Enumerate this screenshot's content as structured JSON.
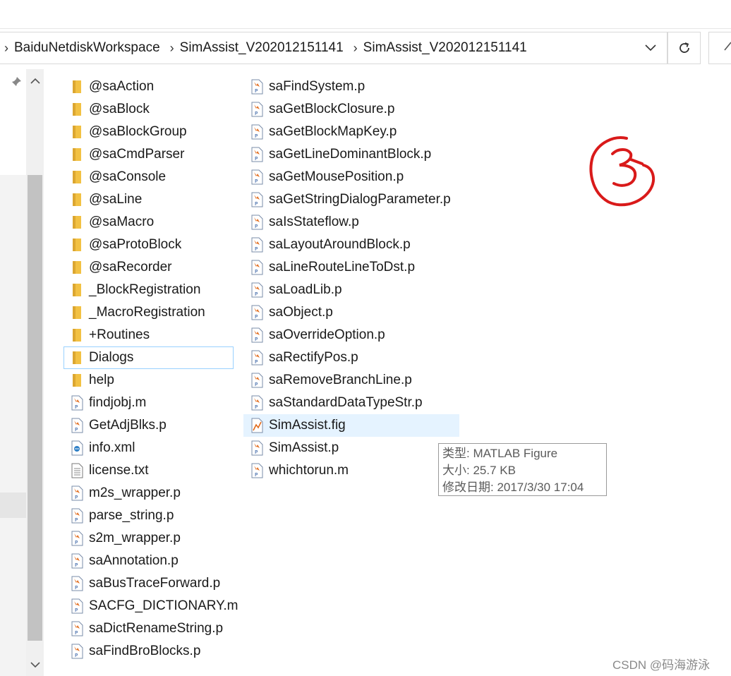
{
  "address_bar": {
    "breadcrumbs": [
      "BaiduNetdiskWorkspace",
      "SimAssist_V202012151141",
      "SimAssist_V202012151141"
    ]
  },
  "folders": [
    "@saAction",
    "@saBlock",
    "@saBlockGroup",
    "@saCmdParser",
    "@saConsole",
    "@saLine",
    "@saMacro",
    "@saProtoBlock",
    "@saRecorder",
    "_BlockRegistration",
    "_MacroRegistration",
    "+Routines",
    "Dialogs",
    "help"
  ],
  "files_col1": [
    {
      "name": "findjobj.m",
      "icon": "matlab-file-icon"
    },
    {
      "name": "GetAdjBlks.p",
      "icon": "matlab-file-icon"
    },
    {
      "name": "info.xml",
      "icon": "xml-file-icon"
    },
    {
      "name": "license.txt",
      "icon": "text-file-icon"
    },
    {
      "name": "m2s_wrapper.p",
      "icon": "matlab-file-icon"
    },
    {
      "name": "parse_string.p",
      "icon": "matlab-file-icon"
    },
    {
      "name": "s2m_wrapper.p",
      "icon": "matlab-file-icon"
    },
    {
      "name": "saAnnotation.p",
      "icon": "matlab-file-icon"
    },
    {
      "name": "saBusTraceForward.p",
      "icon": "matlab-file-icon"
    },
    {
      "name": "SACFG_DICTIONARY.m",
      "icon": "matlab-file-icon"
    },
    {
      "name": "saDictRenameString.p",
      "icon": "matlab-file-icon"
    },
    {
      "name": "saFindBroBlocks.p",
      "icon": "matlab-file-icon"
    }
  ],
  "files_col2": [
    {
      "name": "saFindSystem.p",
      "icon": "matlab-file-icon"
    },
    {
      "name": "saGetBlockClosure.p",
      "icon": "matlab-file-icon"
    },
    {
      "name": "saGetBlockMapKey.p",
      "icon": "matlab-file-icon"
    },
    {
      "name": "saGetLineDominantBlock.p",
      "icon": "matlab-file-icon"
    },
    {
      "name": "saGetMousePosition.p",
      "icon": "matlab-file-icon"
    },
    {
      "name": "saGetStringDialogParameter.p",
      "icon": "matlab-file-icon"
    },
    {
      "name": "saIsStateflow.p",
      "icon": "matlab-file-icon"
    },
    {
      "name": "saLayoutAroundBlock.p",
      "icon": "matlab-file-icon"
    },
    {
      "name": "saLineRouteLineToDst.p",
      "icon": "matlab-file-icon"
    },
    {
      "name": "saLoadLib.p",
      "icon": "matlab-file-icon"
    },
    {
      "name": "saObject.p",
      "icon": "matlab-file-icon"
    },
    {
      "name": "saOverrideOption.p",
      "icon": "matlab-file-icon"
    },
    {
      "name": "saRectifyPos.p",
      "icon": "matlab-file-icon"
    },
    {
      "name": "saRemoveBranchLine.p",
      "icon": "matlab-file-icon"
    },
    {
      "name": "saStandardDataTypeStr.p",
      "icon": "matlab-file-icon"
    },
    {
      "name": "SimAssist.fig",
      "icon": "matlab-figure-icon"
    },
    {
      "name": "SimAssist.p",
      "icon": "matlab-file-icon"
    },
    {
      "name": "whichtorun.m",
      "icon": "matlab-file-icon"
    }
  ],
  "tooltip": {
    "type": "类型: MATLAB Figure",
    "size": "大小: 25.7 KB",
    "modified": "修改日期: 2017/3/30 17:04"
  },
  "watermark": "CSDN @码海游泳",
  "colors": {
    "folder": "#f2c143",
    "focus_border": "#99d1ff",
    "hover_bg": "#e5f3ff",
    "annotation": "#d91a1a"
  }
}
